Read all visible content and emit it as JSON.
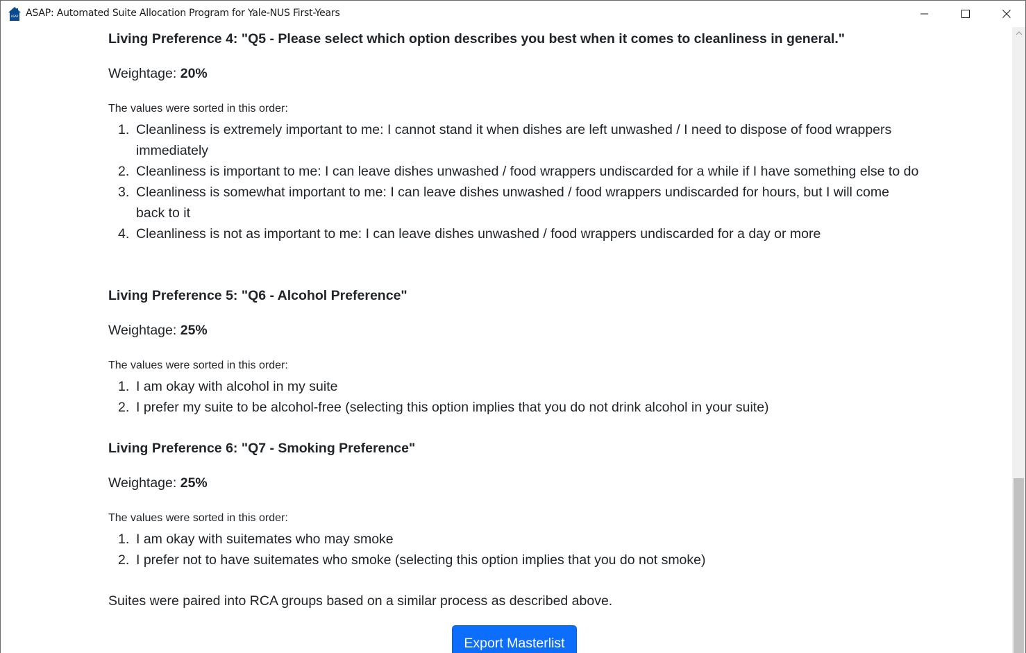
{
  "window": {
    "title": "ASAP: Automated Suite Allocation Program for Yale-NUS First-Years",
    "icon": "house-icon",
    "icon_text": "ASAP",
    "brand_color": "#0b4a8c"
  },
  "sections": [
    {
      "heading": "Living Preference 4: \"Q5 - Please select which option describes you best when it comes to cleanliness in general.\"",
      "weight_label": "Weightage: ",
      "weight_value": "20%",
      "sorted_label": "The values were sorted in this order:",
      "values": [
        "Cleanliness is extremely important to me: I cannot stand it when dishes are left unwashed / I need to dispose of food wrappers immediately",
        "Cleanliness is important to me: I can leave dishes unwashed / food wrappers undiscarded for a while if I have something else to do",
        "Cleanliness is somewhat important to me: I can leave dishes unwashed / food wrappers undiscarded for hours, but I will come back to it",
        "Cleanliness is not as important to me: I can leave dishes unwashed / food wrappers undiscarded for a day or more"
      ]
    },
    {
      "heading": "Living Preference 5: \"Q6 - Alcohol Preference\"",
      "weight_label": "Weightage: ",
      "weight_value": "25%",
      "sorted_label": "The values were sorted in this order:",
      "values": [
        "I am okay with alcohol in my suite",
        "I prefer my suite to be alcohol-free (selecting this option implies that you do not drink alcohol in your suite)"
      ]
    },
    {
      "heading": "Living Preference 6: \"Q7 - Smoking Preference\"",
      "weight_label": "Weightage: ",
      "weight_value": "25%",
      "sorted_label": "The values were sorted in this order:",
      "values": [
        "I am okay with suitemates who may smoke",
        "I prefer not to have suitemates who smoke (selecting this option implies that you do not smoke)"
      ]
    }
  ],
  "summary": "Suites were paired into RCA groups based on a similar process as described above.",
  "export_button": "Export Masterlist",
  "colors": {
    "primary_button": "#0d6efd",
    "text": "#212529"
  }
}
